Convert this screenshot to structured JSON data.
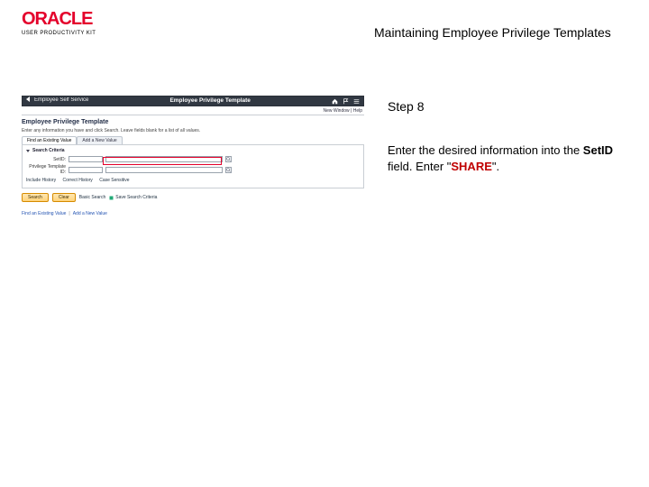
{
  "brand": {
    "name": "ORACLE",
    "subline": "USER PRODUCTIVITY KIT"
  },
  "document": {
    "title": "Maintaining Employee Privilege Templates"
  },
  "step": {
    "label": "Step 8"
  },
  "instruction": {
    "prefix": "Enter the desired information into the ",
    "bold_field": "SetID",
    "middle": " field. Enter \"",
    "share_text": "SHARE",
    "suffix": "\"."
  },
  "screenshot": {
    "appbar": {
      "back_section": "Employee Self Service",
      "page_title": "Employee Privilege Template"
    },
    "top_links": "New Window | Help",
    "page_heading": "Employee Privilege Template",
    "breadcrumb": "Enter any information you have and click Search. Leave fields blank for a list of all values.",
    "tabs": {
      "existing": "Find an Existing Value",
      "add": "Add a New Value"
    },
    "panel_title": "Search Criteria",
    "fields": {
      "setid_label": "SetID:",
      "tmpl_label": "Privilege Template ID:"
    },
    "option_links": {
      "include": "Include History",
      "correct": "Correct History",
      "case": "Case Sensitive"
    },
    "buttons": {
      "search": "Search",
      "clear": "Clear"
    },
    "actions": {
      "basic": "Basic Search",
      "save": "Save Search Criteria"
    },
    "bottom": {
      "existing": "Find an Existing Value",
      "add": "Add a New Value"
    }
  }
}
